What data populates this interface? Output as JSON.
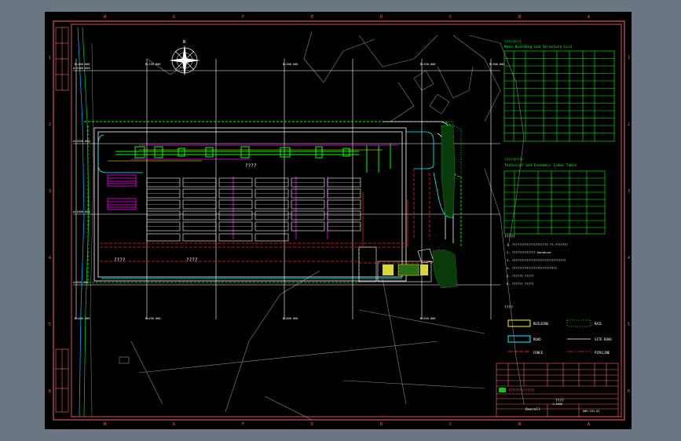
{
  "drawing": {
    "title": "Overall",
    "grid_cols": [
      "H",
      "G",
      "F",
      "E",
      "D",
      "C",
      "B",
      "A"
    ],
    "grid_rows": [
      "1",
      "2",
      "3",
      "4",
      "5",
      "6"
    ],
    "coord_top": [
      "B=100.000",
      "B=150.000",
      "B=200.000",
      "B=250.000",
      "B=300.000"
    ],
    "coord_bottom": [
      "B=400.000",
      "B=450.000",
      "B=500.000",
      "B=550.000"
    ],
    "coord_left": [
      "A=1100.000",
      "A=1050.000",
      "A=1000.000",
      "A=950.000"
    ],
    "building_labels": [
      "????",
      "????",
      "????"
    ],
    "tables": {
      "structures_title": "Main Building and Structure List",
      "structures_num": "????????",
      "indices_title": "Technical and Economic Index Table",
      "indices_num": "?????????"
    },
    "notes": {
      "heading": "?????",
      "lines": [
        "1. ???????????????????? ??.???????",
        "2. ????????????? Handover",
        "3. ??????????????????????????????",
        "4. ?????????????????????????",
        "5. ?????? ?????",
        "6. ?????? ?????"
      ]
    },
    "legend": {
      "heading": "????",
      "items": [
        "BUILDING",
        "ROAD",
        "FENCE",
        "RAIL",
        "SITE ROAD",
        "PIPELINE"
      ]
    },
    "title_block": {
      "company": "??????????????",
      "project": "????",
      "sheet_name": "Overall",
      "drawing_no": "DWG-101-01",
      "scale": "1:1000"
    },
    "colors": {
      "frame": "#ff6a6a",
      "grid": "#ffffff",
      "green": "#00ff00",
      "cyan": "#00ffff",
      "yellow": "#ffff00",
      "magenta": "#ff00ff",
      "red": "#ff2020",
      "gray": "#8a8a8a"
    }
  }
}
